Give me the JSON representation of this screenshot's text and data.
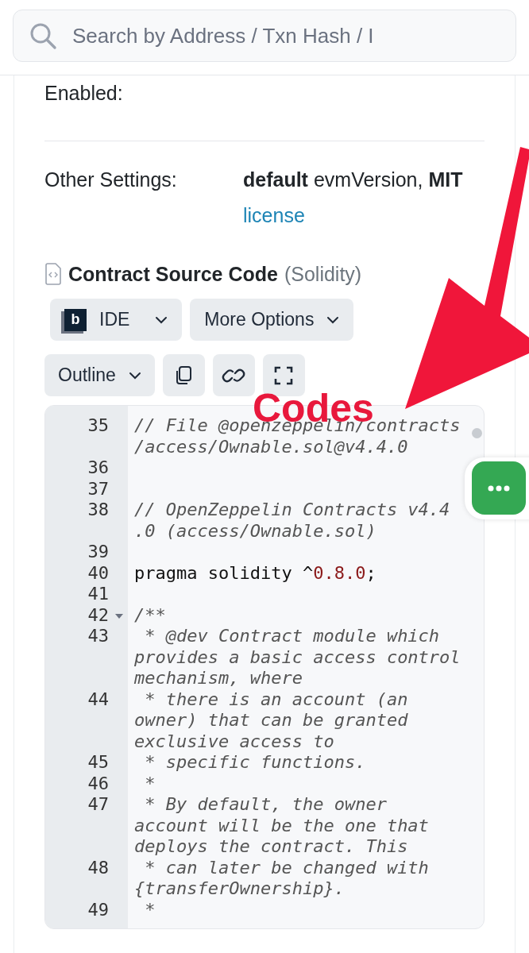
{
  "search": {
    "placeholder": "Search by Address / Txn Hash / I"
  },
  "settings": [
    {
      "label": "Enabled:"
    },
    {
      "label": "Other Settings:",
      "value": "**default** evmVersion, **MIT**",
      "link": "license"
    }
  ],
  "source_code": {
    "title": "Contract Source Code",
    "language": "(Solidity)",
    "buttons": [
      {
        "kind": "ide",
        "logo": "b",
        "label": "IDE"
      },
      {
        "kind": "menu",
        "label": "More Options"
      }
    ],
    "tools": [
      {
        "kind": "menu",
        "label": "Outline"
      },
      {
        "kind": "copy"
      },
      {
        "kind": "link"
      },
      {
        "kind": "fullscreen"
      }
    ],
    "lines": [
      {
        "number": "35",
        "kind": "comment",
        "foldable": false,
        "rows": [
          "// File @openzeppelin/contracts",
          "/access/Ownable.sol@v4.4.0"
        ]
      },
      {
        "number": "36",
        "kind": "blank",
        "foldable": false
      },
      {
        "number": "37",
        "kind": "blank",
        "foldable": false
      },
      {
        "number": "38",
        "kind": "comment",
        "foldable": false,
        "rows": [
          "// OpenZeppelin Contracts v4.4",
          ".0 (access/Ownable.sol)"
        ]
      },
      {
        "number": "39",
        "kind": "blank",
        "foldable": false
      },
      {
        "number": "40",
        "kind": "code",
        "foldable": false,
        "tokens": [
          {
            "kind": "plain",
            "text": "pragma solidity ^"
          },
          {
            "kind": "number",
            "text": "0.8.0"
          },
          {
            "kind": "plain",
            "text": ";"
          }
        ]
      },
      {
        "number": "41",
        "kind": "blank",
        "foldable": false
      },
      {
        "number": "42",
        "kind": "comment",
        "foldable": true,
        "rows": [
          "/**"
        ]
      },
      {
        "number": "43",
        "kind": "comment",
        "foldable": false,
        "rows": [
          " * @dev Contract module which",
          "provides a basic access control",
          "mechanism, where"
        ]
      },
      {
        "number": "44",
        "kind": "comment",
        "foldable": false,
        "rows": [
          " * there is an account (an",
          "owner) that can be granted",
          "exclusive access to"
        ]
      },
      {
        "number": "45",
        "kind": "comment",
        "foldable": false,
        "rows": [
          " * specific functions."
        ]
      },
      {
        "number": "46",
        "kind": "comment",
        "foldable": false,
        "rows": [
          " *"
        ]
      },
      {
        "number": "47",
        "kind": "comment",
        "foldable": false,
        "rows": [
          " * By default, the owner",
          "account will be the one that",
          "deploys the contract. This"
        ]
      },
      {
        "number": "48",
        "kind": "comment",
        "foldable": false,
        "rows": [
          " * can later be changed with",
          "{transferOwnership}."
        ]
      },
      {
        "number": "49",
        "kind": "comment",
        "foldable": false,
        "rows": [
          " *"
        ]
      }
    ]
  },
  "annotation": {
    "label": "Codes"
  }
}
